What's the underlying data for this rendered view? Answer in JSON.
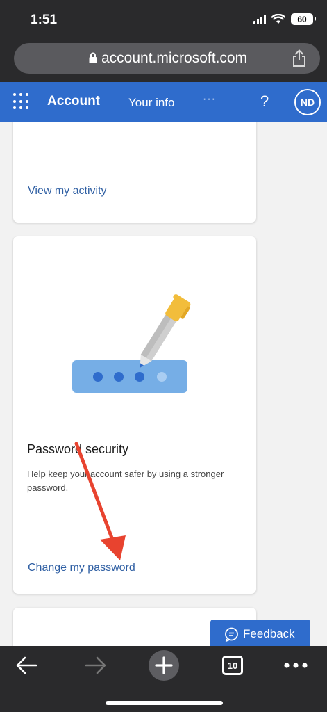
{
  "status_bar": {
    "time": "1:51",
    "battery": "60"
  },
  "browser": {
    "url": "account.microsoft.com",
    "tab_count": "10"
  },
  "header": {
    "brand": "Account",
    "nav_label": "Your info",
    "more": "···",
    "help": "?",
    "avatar_initials": "ND"
  },
  "cards": {
    "activity": {
      "link": "View my activity"
    },
    "password": {
      "title": "Password security",
      "description": "Help keep your account safer by using a stronger password.",
      "link": "Change my password"
    }
  },
  "feedback": {
    "label": "Feedback"
  },
  "colors": {
    "accent": "#2f6ccc",
    "link": "#2f5fa3",
    "arrow": "#e8432f"
  }
}
